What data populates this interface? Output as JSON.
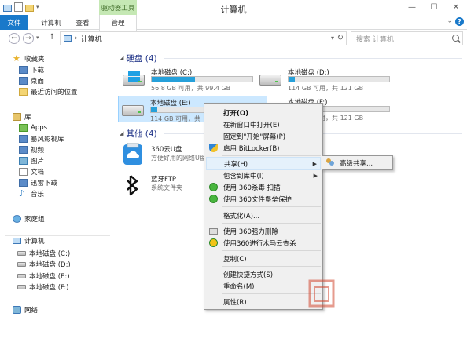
{
  "titlebar": {
    "title": "计算机",
    "context_tab": "驱动器工具",
    "controls": {
      "minimize": "—",
      "maximize": "☐",
      "close": "✕"
    }
  },
  "ribbon": {
    "tabs": [
      "文件",
      "计算机",
      "查看",
      "管理"
    ],
    "expand_icon": "chevron-down-icon",
    "help": "?"
  },
  "address": {
    "back": "←",
    "forward": "→",
    "recent": "▾",
    "up": "↑",
    "separator": "›",
    "path": "计算机",
    "dropdown": "▾",
    "refresh": "↻",
    "search_placeholder": "搜索 计算机"
  },
  "nav": {
    "favorites": {
      "label": "收藏夹",
      "items": [
        "下载",
        "桌面",
        "最近访问的位置"
      ]
    },
    "libraries": {
      "label": "库",
      "items": [
        "Apps",
        "暴风影视库",
        "视频",
        "图片",
        "文档",
        "迅雷下载",
        "音乐"
      ]
    },
    "homegroup": "家庭组",
    "computer": {
      "label": "计算机",
      "items": [
        "本地磁盘 (C:)",
        "本地磁盘 (D:)",
        "本地磁盘 (E:)",
        "本地磁盘 (F:)"
      ]
    },
    "network": "网络"
  },
  "content": {
    "hdd_group": "硬盘 (4)",
    "other_group": "其他 (4)",
    "drives": [
      {
        "name": "本地磁盘 (C:)",
        "size": "56.8 GB 可用，共 99.4 GB",
        "used_fraction": 0.43
      },
      {
        "name": "本地磁盘 (D:)",
        "size": "114 GB 可用，共 121 GB",
        "used_fraction": 0.06
      },
      {
        "name": "本地磁盘 (E:)",
        "size": "114 GB 可用，共",
        "used_fraction": 0.06
      },
      {
        "name": "本地磁盘 (F:)",
        "size": "114 GB 可用，共 121 GB",
        "used_fraction": 0.06
      }
    ],
    "others": [
      {
        "name": "360云U盘",
        "desc": "方便好用的网络U盘"
      },
      {
        "name": "蓝牙FTP",
        "desc": "系统文件夹"
      }
    ]
  },
  "context_menu": {
    "items": [
      "打开(O)",
      "在新窗口中打开(E)",
      "固定到\"开始\"屏幕(P)",
      "启用 BitLocker(B)",
      "共享(H)",
      "包含到库中(I)",
      "使用 360杀毒 扫描",
      "使用 360文件堡垒保护",
      "格式化(A)...",
      "使用 360强力删除",
      "使用360进行木马云查杀",
      "复制(C)",
      "创建快捷方式(S)",
      "重命名(M)",
      "属性(R)"
    ],
    "submenu_arrow": "▶",
    "share_submenu": [
      "高级共享..."
    ]
  }
}
